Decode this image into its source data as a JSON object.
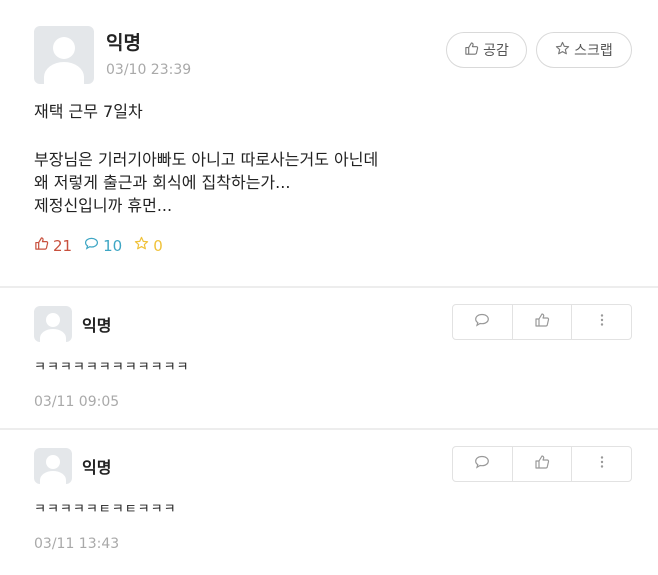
{
  "post": {
    "author": "익명",
    "time": "03/10 23:39",
    "like_button_label": "공감",
    "scrap_button_label": "스크랩",
    "title": "재택 근무 7일차",
    "body_lines": [
      "부장님은 기러기아빠도 아니고 따로사는거도 아닌데",
      "왜 저렇게 출근과 회식에 집착하는가...",
      "제정신입니까 휴먼..."
    ],
    "stats": {
      "likes": "21",
      "comments": "10",
      "scraps": "0"
    }
  },
  "comments": [
    {
      "author": "익명",
      "text": "ㅋㅋㅋㅋㅋㅋㅋㅋㅋㅋㅋㅋ",
      "time": "03/11 09:05"
    },
    {
      "author": "익명",
      "text": "ㅋㅋㅋㅋㅋㅌㅋㅌㅋㅋㅋ",
      "time": "03/11 13:43"
    }
  ],
  "icons": {
    "like": "thumb-up-icon",
    "scrap": "star-icon",
    "comment": "speech-bubble-icon",
    "more": "more-vertical-icon"
  },
  "colors": {
    "like_stat": "#c8513e",
    "comment_stat": "#3ea6c4",
    "scrap_stat": "#f0c23a",
    "timestamp": "#a9a9a9"
  }
}
